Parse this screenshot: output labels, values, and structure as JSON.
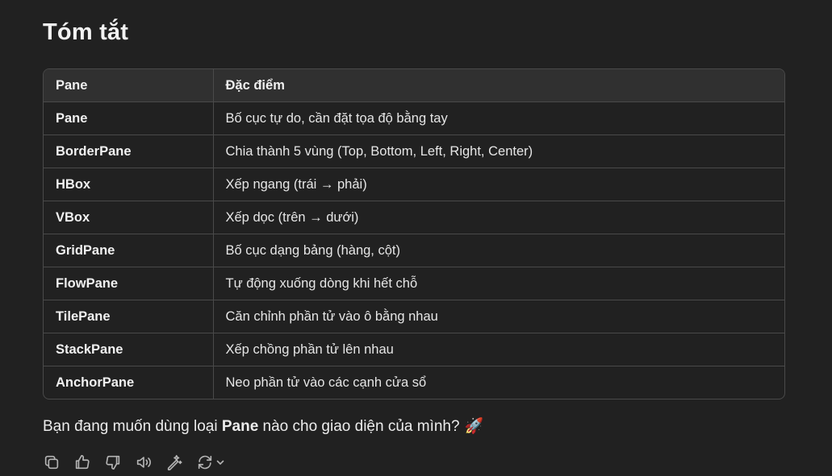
{
  "heading": "Tóm tắt",
  "table": {
    "headers": [
      "Pane",
      "Đặc điểm"
    ],
    "rows": [
      [
        "Pane",
        "Bố cục tự do, cần đặt tọa độ bằng tay"
      ],
      [
        "BorderPane",
        "Chia thành 5 vùng (Top, Bottom, Left, Right, Center)"
      ],
      [
        "HBox",
        "Xếp ngang (trái → phải)"
      ],
      [
        "VBox",
        "Xếp dọc (trên → dưới)"
      ],
      [
        "GridPane",
        "Bố cục dạng bảng (hàng, cột)"
      ],
      [
        "FlowPane",
        "Tự động xuống dòng khi hết chỗ"
      ],
      [
        "TilePane",
        "Căn chỉnh phần tử vào ô bằng nhau"
      ],
      [
        "StackPane",
        "Xếp chồng phần tử lên nhau"
      ],
      [
        "AnchorPane",
        "Neo phần tử vào các cạnh cửa sổ"
      ]
    ]
  },
  "closing": {
    "before": "Bạn đang muốn dùng loại ",
    "bold": "Pane",
    "after": " nào cho giao diện của mình?",
    "emoji": "🚀"
  },
  "actions": [
    {
      "name": "copy-icon"
    },
    {
      "name": "thumbs-up-icon"
    },
    {
      "name": "thumbs-down-icon"
    },
    {
      "name": "read-aloud-icon"
    },
    {
      "name": "edit-magic-icon"
    },
    {
      "name": "regenerate-icon"
    }
  ]
}
